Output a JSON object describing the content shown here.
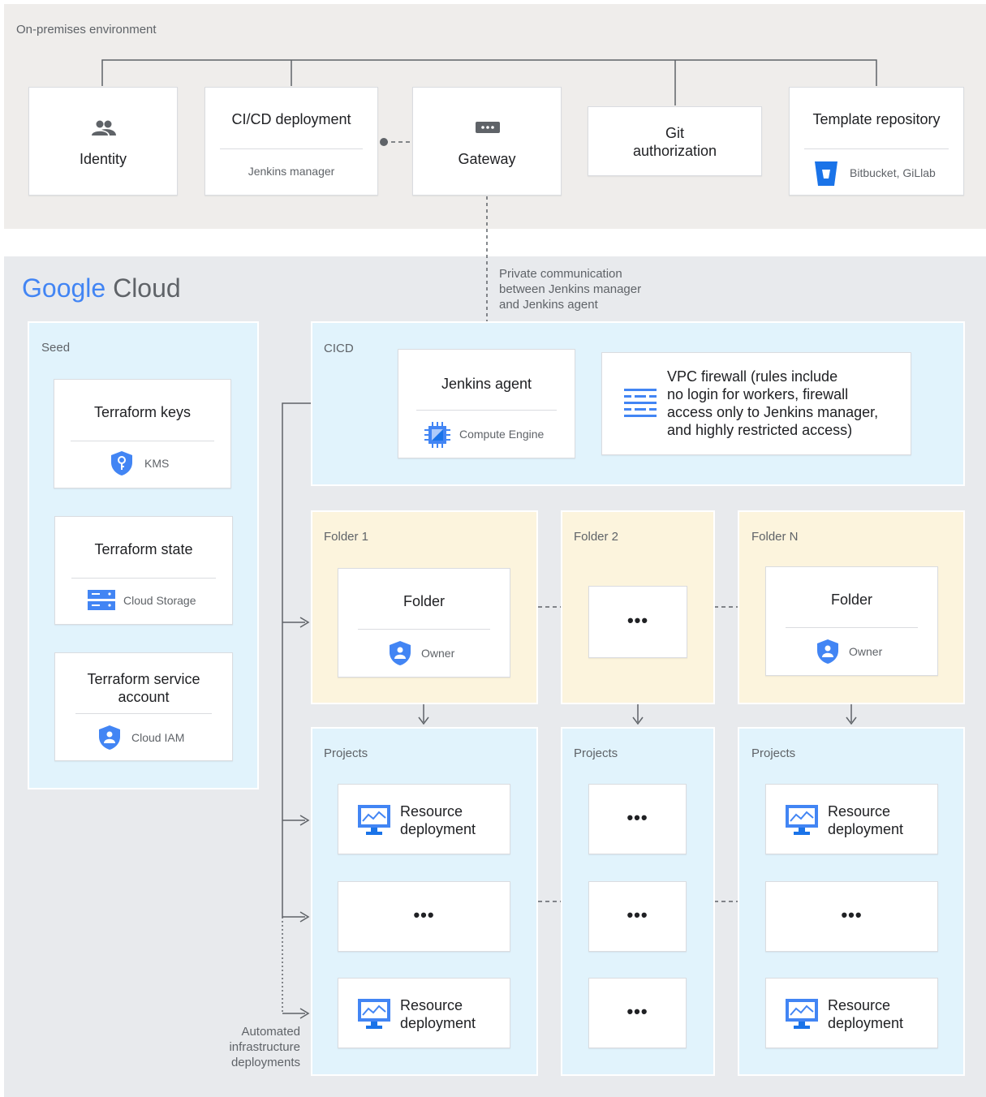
{
  "onprem": {
    "label": "On-premises environment",
    "identity": "Identity",
    "cicd": {
      "title": "CI/CD deployment",
      "sub": "Jenkins manager"
    },
    "gateway": "Gateway",
    "git": {
      "line1": "Git",
      "line2": "authorization"
    },
    "template": {
      "title": "Template repository",
      "sub": "Bitbucket, GiLlab"
    }
  },
  "gcp": {
    "logo_google": "Google",
    "logo_cloud": "Cloud",
    "private_note": [
      "Private communication",
      "between Jenkins manager",
      "and Jenkins agent"
    ],
    "seed": {
      "label": "Seed",
      "keys": {
        "title": "Terraform keys",
        "sub": "KMS"
      },
      "state": {
        "title": "Terraform state",
        "sub": "Cloud Storage"
      },
      "sa": {
        "line1": "Terraform service",
        "line2": "account",
        "sub": "Cloud IAM"
      }
    },
    "cicd": {
      "label": "CICD",
      "agent": {
        "title": "Jenkins agent",
        "sub": "Compute Engine"
      },
      "vpc": [
        "VPC firewall (rules include",
        "no login for workers, firewall",
        "access only to Jenkins manager,",
        "and highly restricted access)"
      ]
    },
    "folders": {
      "f1": {
        "label": "Folder 1",
        "title": "Folder",
        "sub": "Owner"
      },
      "f2": {
        "label": "Folder 2",
        "dots": "•••"
      },
      "fn": {
        "label": "Folder N",
        "title": "Folder",
        "sub": "Owner"
      }
    },
    "projects": {
      "label": "Projects",
      "resource_line1": "Resource",
      "resource_line2": "deployment",
      "dots": "•••"
    },
    "automated_note": [
      "Automated",
      "infrastructure",
      "deployments"
    ]
  },
  "colors": {
    "onprem_bg": "#efedeb",
    "gcp_bg": "#e8eaed",
    "blue_panel": "#e1f3fc",
    "yellow_panel": "#fcf4dd",
    "icon_blue": "#4285f4",
    "icon_blue_dark": "#1a73e8"
  }
}
